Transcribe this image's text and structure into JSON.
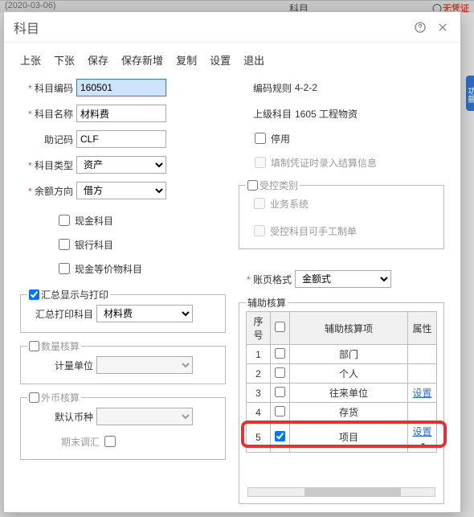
{
  "bg": {
    "date": "(2020-03-06)",
    "label": "科目",
    "sigh": "无凭证"
  },
  "dialog": {
    "title": "科目"
  },
  "toolbar": {
    "prev": "上张",
    "next": "下张",
    "save": "保存",
    "saveNew": "保存新增",
    "copy": "复制",
    "settings": "设置",
    "exit": "退出"
  },
  "left": {
    "codeLabel": "科目编码",
    "code": "160501",
    "nameLabel": "科目名称",
    "name": "材料费",
    "mnemLabel": "助记码",
    "mnem": "CLF",
    "typeLabel": "科目类型",
    "type": "资产",
    "dirLabel": "余额方向",
    "dir": "借方",
    "cash": "现金科目",
    "bank": "银行科目",
    "cashEq": "现金等价物科目",
    "sumGroup": "汇总显示与打印",
    "sumAcctLabel": "汇总打印科目",
    "sumAcct": "材料费",
    "qtyGroup": "数量核算",
    "unitLabel": "计量单位",
    "fxGroup": "外币核算",
    "currLabel": "默认币种",
    "periodEnd": "期末调汇"
  },
  "right": {
    "ruleLabel": "编码规则",
    "rule": "4-2-2",
    "parentLabel": "上级科目",
    "parent": "1605 工程物资",
    "disable": "停用",
    "settleInfo": "填制凭证时录入结算信息",
    "ctrlGroup": "受控类别",
    "bizsys": "业务系统",
    "manual": "受控科目可手工制单",
    "fmtLabel": "账页格式",
    "fmt": "金额式",
    "auxGroup": "辅助核算",
    "cols": {
      "seq": "序号",
      "item": "辅助核算项",
      "attr": "属性"
    },
    "rows": [
      {
        "seq": "1",
        "item": "部门",
        "link": ""
      },
      {
        "seq": "2",
        "item": "个人",
        "link": ""
      },
      {
        "seq": "3",
        "item": "往来单位",
        "link": "设置"
      },
      {
        "seq": "4",
        "item": "存货",
        "link": ""
      },
      {
        "seq": "5",
        "item": "项目",
        "link": "设置",
        "checked": true
      }
    ]
  },
  "sideTab": "功能"
}
